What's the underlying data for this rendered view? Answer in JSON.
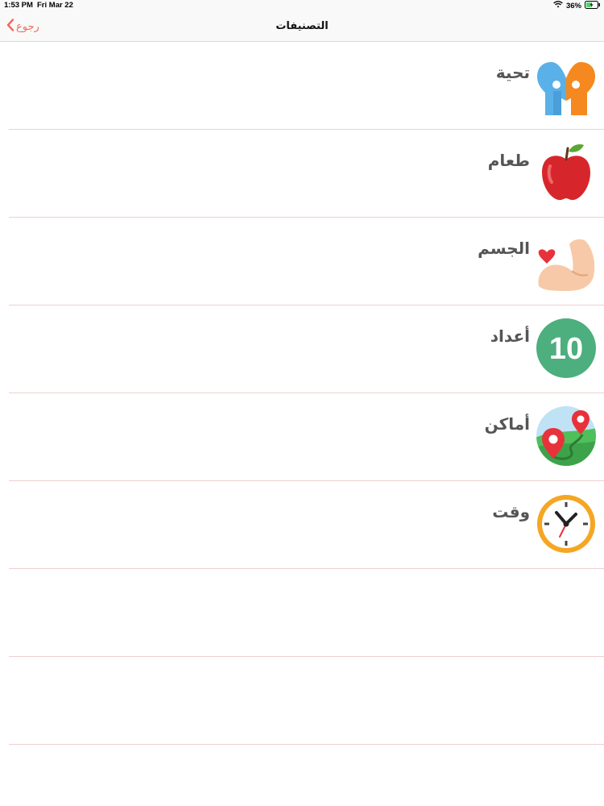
{
  "status_bar": {
    "time": "1:53 PM",
    "date": "Fri Mar 22",
    "battery": "36%"
  },
  "nav": {
    "title": "التصنيفات",
    "back_label": "رجوع"
  },
  "categories": [
    {
      "label": "تحية",
      "icon": "greeting-people-heart-icon"
    },
    {
      "label": "طعام",
      "icon": "apple-icon"
    },
    {
      "label": "الجسم",
      "icon": "flexed-arm-heart-icon"
    },
    {
      "label": "أعداد",
      "icon": "number-ten-icon",
      "icon_text": "10"
    },
    {
      "label": "أماكن",
      "icon": "map-pins-icon"
    },
    {
      "label": "وقت",
      "icon": "clock-icon"
    }
  ],
  "colors": {
    "accent": "#f26b5b",
    "separator": "#efd0d0",
    "label": "#555555",
    "numbers_circle": "#4caf7d",
    "clock_ring": "#f5a623"
  }
}
